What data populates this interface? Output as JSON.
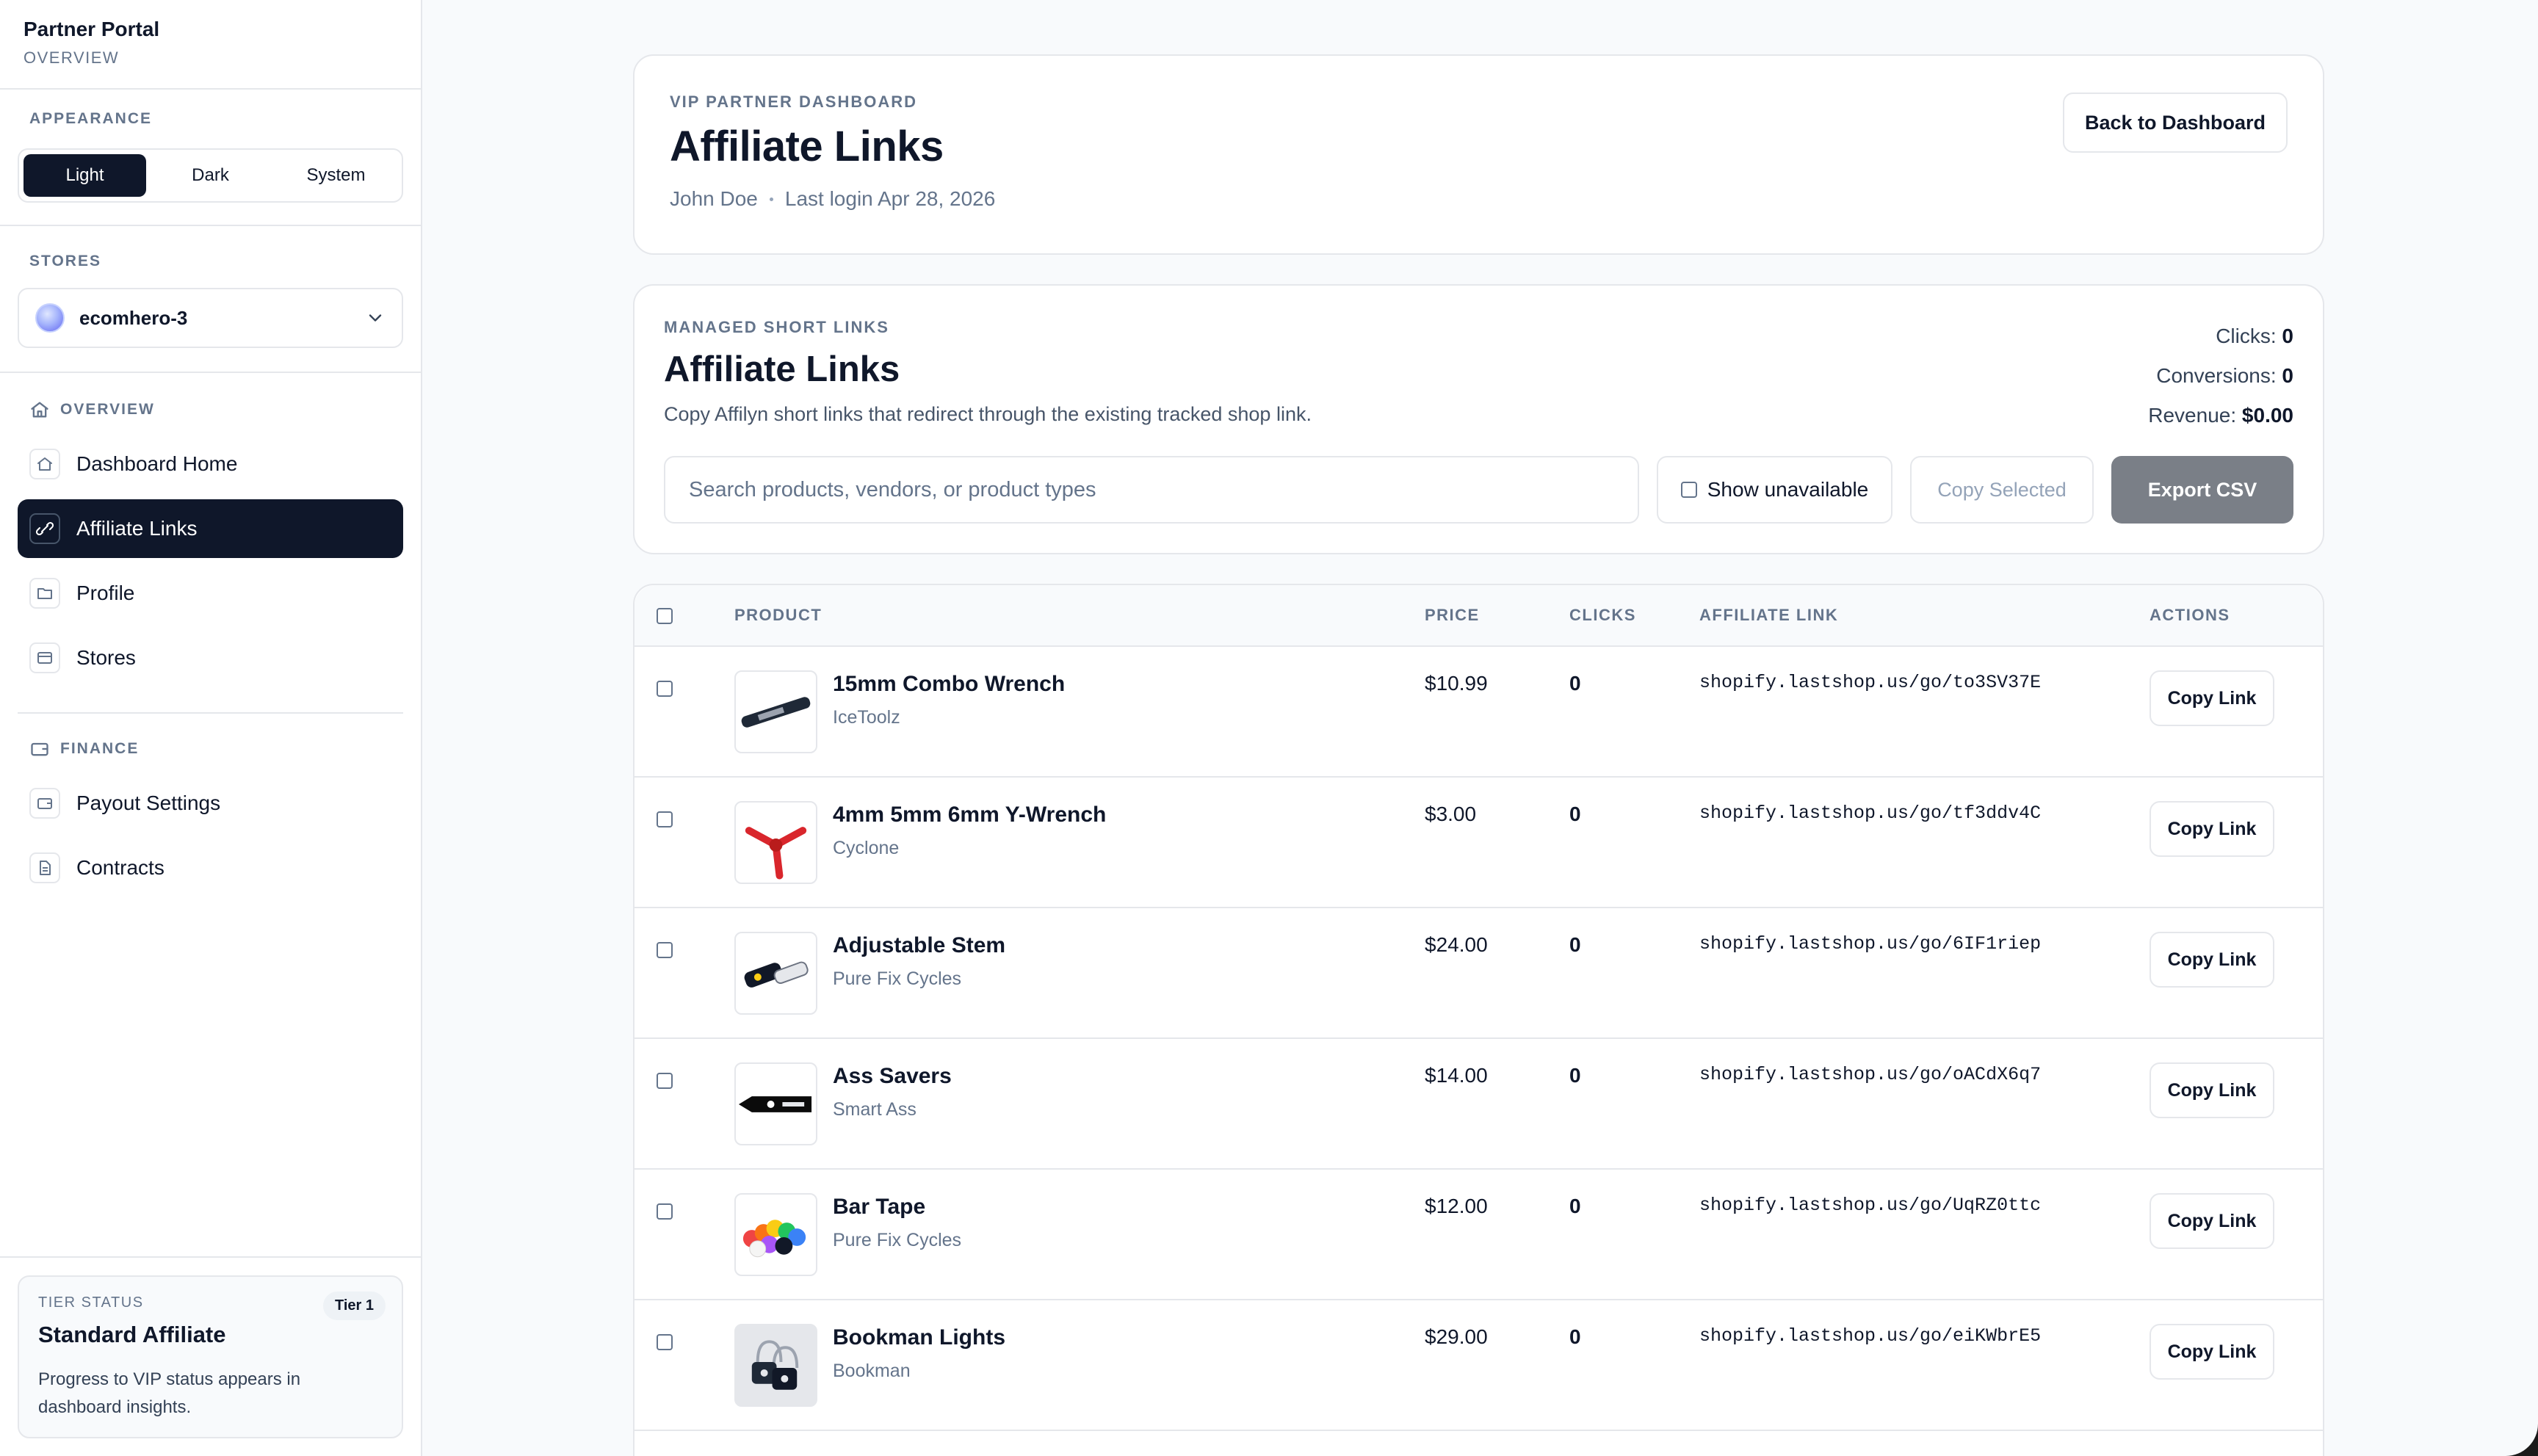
{
  "sidebar": {
    "brand_title": "Partner Portal",
    "brand_sub": "OVERVIEW",
    "appearance_label": "APPEARANCE",
    "theme_options": [
      "Light",
      "Dark",
      "System"
    ],
    "theme_selected": "Light",
    "stores_label": "STORES",
    "store_selected": "ecomhero-3",
    "overview_label": "OVERVIEW",
    "overview_items": [
      {
        "label": "Dashboard Home",
        "icon": "home-icon"
      },
      {
        "label": "Affiliate Links",
        "icon": "link-icon",
        "active": true
      },
      {
        "label": "Profile",
        "icon": "folder-icon"
      },
      {
        "label": "Stores",
        "icon": "store-icon"
      }
    ],
    "finance_label": "FINANCE",
    "finance_items": [
      {
        "label": "Payout Settings",
        "icon": "wallet-icon"
      },
      {
        "label": "Contracts",
        "icon": "document-icon"
      }
    ],
    "tier": {
      "label": "TIER STATUS",
      "badge": "Tier 1",
      "title": "Standard Affiliate",
      "desc": "Progress to VIP status appears in dashboard insights."
    }
  },
  "hero": {
    "kicker": "VIP PARTNER DASHBOARD",
    "title": "Affiliate Links",
    "user": "John Doe",
    "last_login": "Last login Apr 28, 2026",
    "back_button": "Back to Dashboard"
  },
  "links": {
    "kicker": "MANAGED SHORT LINKS",
    "title": "Affiliate Links",
    "desc": "Copy Affilyn short links that redirect through the existing tracked shop link.",
    "stats": {
      "clicks_label": "Clicks:",
      "clicks": "0",
      "conversions_label": "Conversions:",
      "conversions": "0",
      "revenue_label": "Revenue:",
      "revenue": "$0.00"
    },
    "search_placeholder": "Search products, vendors, or product types",
    "show_unavailable": "Show unavailable",
    "copy_selected": "Copy Selected",
    "export_csv": "Export CSV"
  },
  "table": {
    "headers": {
      "product": "PRODUCT",
      "price": "PRICE",
      "clicks": "CLICKS",
      "link": "AFFILIATE LINK",
      "actions": "ACTIONS"
    },
    "copy_label": "Copy Link",
    "rows": [
      {
        "name": "15mm Combo Wrench",
        "vendor": "IceToolz",
        "price": "$10.99",
        "clicks": "0",
        "link": "shopify.lastshop.us/go/to3SV37E",
        "thumb": "wrench"
      },
      {
        "name": "4mm 5mm 6mm Y-Wrench",
        "vendor": "Cyclone",
        "price": "$3.00",
        "clicks": "0",
        "link": "shopify.lastshop.us/go/tf3ddv4C",
        "thumb": "ywrench"
      },
      {
        "name": "Adjustable Stem",
        "vendor": "Pure Fix Cycles",
        "price": "$24.00",
        "clicks": "0",
        "link": "shopify.lastshop.us/go/6IF1riep",
        "thumb": "stem"
      },
      {
        "name": "Ass Savers",
        "vendor": "Smart Ass",
        "price": "$14.00",
        "clicks": "0",
        "link": "shopify.lastshop.us/go/oACdX6q7",
        "thumb": "strap"
      },
      {
        "name": "Bar Tape",
        "vendor": "Pure Fix Cycles",
        "price": "$12.00",
        "clicks": "0",
        "link": "shopify.lastshop.us/go/UqRZ0ttc",
        "thumb": "tape"
      },
      {
        "name": "Bookman Lights",
        "vendor": "Bookman",
        "price": "$29.00",
        "clicks": "0",
        "link": "shopify.lastshop.us/go/eiKWbrE5",
        "thumb": "lights"
      }
    ]
  }
}
